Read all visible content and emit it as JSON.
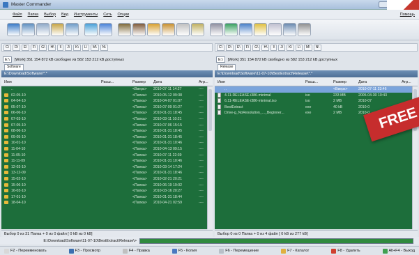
{
  "window": {
    "title": "Master Commander"
  },
  "menu": {
    "items": [
      "Файл",
      "Папка",
      "Выбор",
      "Вид",
      "Инструменты",
      "Сеть",
      "Опции"
    ],
    "help": "Помощь"
  },
  "toolbar": {
    "icons": [
      "refresh-icon",
      "view-brief-icon",
      "view-detail-icon",
      "view-thumbs-icon",
      "sort-icon",
      "back-icon",
      "forward-icon",
      "pack-icon",
      "unpack-icon",
      "lock-icon",
      "unlock-icon",
      "search-icon",
      "edit-icon",
      "tools-icon",
      "network-icon",
      "ftp-icon",
      "compare-icon",
      "sync-icon",
      "terminal-icon",
      "settings-icon"
    ],
    "colors": [
      "#3b7bc7",
      "#5f8fc0",
      "#8fa9c8",
      "#c7a548",
      "#6f9cc8",
      "#4aa0d8",
      "#4a82d8",
      "#7f6a3a",
      "#7f5a3a",
      "#d8a030",
      "#c89030",
      "#c0c0c0",
      "#c0b060",
      "#9090a0",
      "#3aa060",
      "#4a80c8",
      "#e0c040",
      "#c0c0d0",
      "#6a8ab0",
      "#909090"
    ]
  },
  "left": {
    "drives": [
      "C\\",
      "D\\",
      "E\\",
      "F\\",
      "G\\",
      "H\\",
      "I\\",
      "J\\",
      "K\\",
      "L\\",
      "M\\",
      "N\\"
    ],
    "disk": "E:\\",
    "free_info": "[Work] 351 154 872 kB свободно из 582 153 212 kB доступных",
    "tab": "Software",
    "path": "E:\\Download\\Software\\*.*",
    "headers": {
      "name": "Имя",
      "ext": "Расш...",
      "size": "Размер",
      "date": "Дата",
      "attr": "Атр..."
    },
    "rows": [
      {
        "name": "..",
        "size": "<Вверх>",
        "date": "2010-07-11 14:27",
        "attr": "----",
        "type": "up"
      },
      {
        "name": "02-05-10",
        "size": "<Папка>",
        "date": "2010-05-12 09:38",
        "attr": "----",
        "type": "folder"
      },
      {
        "name": "04-04-10",
        "size": "<Папка>",
        "date": "2010-04-07 01:07",
        "attr": "----",
        "type": "folder"
      },
      {
        "name": "05-07-10",
        "size": "<Папка>",
        "date": "2010-07-09 01:27",
        "attr": "----",
        "type": "folder"
      },
      {
        "name": "06-06-10",
        "size": "<Папка>",
        "date": "2010-01-31 18:45",
        "attr": "----",
        "type": "folder"
      },
      {
        "name": "07-03-10",
        "size": "<Папка>",
        "date": "2010-03-11 10:21",
        "attr": "----",
        "type": "folder"
      },
      {
        "name": "07-05-10",
        "size": "<Папка>",
        "date": "2010-07-06 15:15",
        "attr": "----",
        "type": "folder"
      },
      {
        "name": "08-06-10",
        "size": "<Папка>",
        "date": "2010-01-31 18:45",
        "attr": "----",
        "type": "folder"
      },
      {
        "name": "09-05-10",
        "size": "<Папка>",
        "date": "2010-01-31 18:45",
        "attr": "----",
        "type": "folder"
      },
      {
        "name": "10-01-10",
        "size": "<Папка>",
        "date": "2010-01-31 10:46",
        "attr": "----",
        "type": "folder"
      },
      {
        "name": "11-04-10",
        "size": "<Папка>",
        "date": "2010-04-13 09:15",
        "attr": "----",
        "type": "folder"
      },
      {
        "name": "11-05-10",
        "size": "<Папка>",
        "date": "2010-07-11 22:39",
        "attr": "----",
        "type": "folder"
      },
      {
        "name": "11-11-09",
        "size": "<Папка>",
        "date": "2010-01-31 10:46",
        "attr": "----",
        "type": "folder"
      },
      {
        "name": "12-03-10",
        "size": "<Папка>",
        "date": "2010-03-14 17:24",
        "attr": "----",
        "type": "folder"
      },
      {
        "name": "13-12-09",
        "size": "<Папка>",
        "date": "2010-01-31 18:46",
        "attr": "----",
        "type": "folder"
      },
      {
        "name": "15-02-10",
        "size": "<Папка>",
        "date": "2010-02-21 20:21",
        "attr": "----",
        "type": "folder"
      },
      {
        "name": "15-06-10",
        "size": "<Папка>",
        "date": "2010-06-19 19:02",
        "attr": "----",
        "type": "folder"
      },
      {
        "name": "16-03-10",
        "size": "<Папка>",
        "date": "2010-03-16 20:27",
        "attr": "----",
        "type": "folder"
      },
      {
        "name": "17-01-10",
        "size": "<Папка>",
        "date": "2010-01-31 18:44",
        "attr": "----",
        "type": "folder"
      },
      {
        "name": "18-04-10",
        "size": "<Папка>",
        "date": "2010-04-21 02:59",
        "attr": "----",
        "type": "folder"
      }
    ],
    "status": "Выбор 0 из 31 Папка + 0 из 0 файл [ 0 kB из 0 kB]"
  },
  "right": {
    "drives": [
      "C\\",
      "D\\",
      "E\\",
      "F\\",
      "G\\",
      "H\\",
      "I\\",
      "J\\",
      "K\\",
      "L\\",
      "M\\",
      "N\\"
    ],
    "disk": "E:\\",
    "free_info": "[Work] 351 154 872 kB свободно из 582 153 212 kB доступных",
    "tab": "Release",
    "path": "E:\\Download\\Software\\11-07-10\\BestExtract\\Release\\*.*",
    "headers": {
      "name": "Имя",
      "ext": "Расш...",
      "size": "Размер",
      "date": "Дата",
      "attr": "Атр..."
    },
    "rows": [
      {
        "name": "..",
        "ext": "",
        "size": "<Вверх>",
        "date": "2010-07-11 23:46",
        "attr": "",
        "type": "up",
        "selected": true
      },
      {
        "name": "4.11-RELEASE-i386-minimal",
        "ext": "iso",
        "size": "233 MB",
        "date": "2005-04-30 10:43",
        "attr": "",
        "type": "file"
      },
      {
        "name": "6.11-RELEASE-i386-minimal.iso",
        "ext": "iso",
        "size": "2 MB",
        "date": "2010-07",
        "attr": "",
        "type": "file"
      },
      {
        "name": "BestExtract",
        "ext": "exe",
        "size": "40 kB",
        "date": "2010-0",
        "attr": "",
        "type": "file"
      },
      {
        "name": "Drive-g_NoResolution_..._Beginner...",
        "ext": "exe",
        "size": "2 MB",
        "date": "2010-0",
        "attr": "",
        "type": "file"
      }
    ],
    "status": "Выбор 0 из 0 Папка + 0 из 4 файл [ 0 kB из 277 kB]"
  },
  "cmdline": {
    "prompt": "E:\\Download\\Software\\11-07-10\\BestExtract\\Release\\>"
  },
  "fkeys": [
    {
      "label": "F2 - Переименовать",
      "color": "#d8d8d8"
    },
    {
      "label": "F3 - Просмотр",
      "color": "#3b6fb0"
    },
    {
      "label": "F4 - Правка",
      "color": "#c0c0c0"
    },
    {
      "label": "F5 - Копия",
      "color": "#4a78c0"
    },
    {
      "label": "F6 - Перемещение",
      "color": "#b8c0c8"
    },
    {
      "label": "F7 - Каталог",
      "color": "#e0b040"
    },
    {
      "label": "F8 - Удалить",
      "color": "#d04030"
    },
    {
      "label": "Alt+F4 - Выход",
      "color": "#40a050"
    }
  ],
  "badge": {
    "text": "FREE"
  }
}
